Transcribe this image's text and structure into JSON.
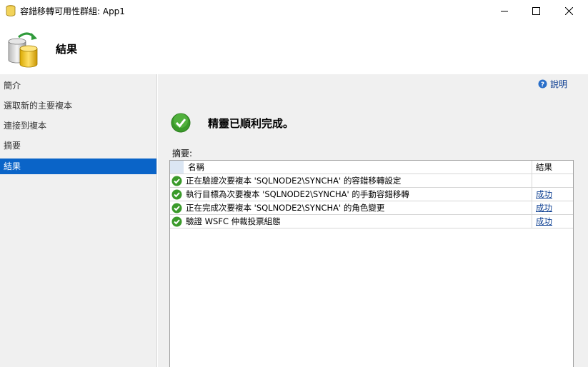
{
  "window": {
    "title": "容錯移轉可用性群組: App1",
    "app_icon": "database-icon",
    "controls": [
      "minimize-icon",
      "maximize-icon",
      "close-icon"
    ]
  },
  "header": {
    "title": "結果",
    "icon": "database-sync-icon"
  },
  "sidebar": {
    "items": [
      {
        "label": "簡介",
        "active": false
      },
      {
        "label": "選取新的主要複本",
        "active": false
      },
      {
        "label": "連接到複本",
        "active": false
      },
      {
        "label": "摘要",
        "active": false
      },
      {
        "label": "結果",
        "active": true
      }
    ]
  },
  "main": {
    "help_label": "說明",
    "success_message": "精靈已順利完成。",
    "summary_label": "摘要:",
    "table": {
      "columns": [
        "名稱",
        "結果"
      ],
      "rows": [
        {
          "name": "正在驗證次要複本 'SQLNODE2\\SYNCHA' 的容錯移轉設定",
          "result": ""
        },
        {
          "name": "執行目標為次要複本 'SQLNODE2\\SYNCHA' 的手動容錯移轉",
          "result": "成功"
        },
        {
          "name": "正在完成次要複本 'SQLNODE2\\SYNCHA' 的角色變更",
          "result": "成功"
        },
        {
          "name": "驗證 WSFC 仲裁投票組態",
          "result": "成功"
        }
      ]
    }
  },
  "colors": {
    "accent": "#0a64c8",
    "success": "#3a9a2a",
    "link": "#0b3d91"
  }
}
